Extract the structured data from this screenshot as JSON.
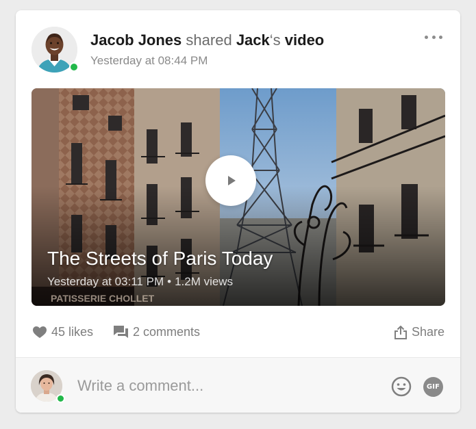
{
  "post": {
    "author": "Jacob Jones",
    "verb": "shared",
    "owner": "Jack",
    "owner_suffix": "‘s",
    "object": "video",
    "timestamp": "Yesterday at 08:44 PM"
  },
  "video": {
    "title": "The Streets of Paris Today",
    "date": "Yesterday at 03:11 PM",
    "separator": "•",
    "views": "1.2M views",
    "storefront_text": "PATISSERIE CHOLLET"
  },
  "actions": {
    "likes": "45 likes",
    "comments": "2 comments",
    "share": "Share"
  },
  "composer": {
    "placeholder": "Write a comment...",
    "gif_label": "GIF"
  },
  "colors": {
    "online": "#22b84a",
    "card_bg": "#ffffff",
    "page_bg": "#ececec",
    "muted_text": "#7d7d7d"
  },
  "icons": [
    "more-horizontal-icon",
    "play-icon",
    "heart-icon",
    "comment-icon",
    "share-icon",
    "emoji-icon",
    "gif-icon"
  ]
}
